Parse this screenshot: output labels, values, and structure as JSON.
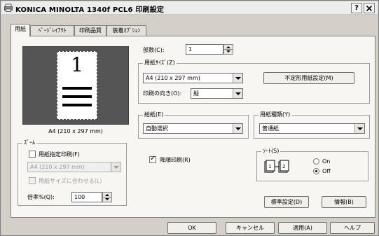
{
  "window": {
    "title": "KONICA MINOLTA 1340f PCL6 印刷設定",
    "help_button": "?",
    "close_button": "X"
  },
  "tabs": [
    {
      "label": "用紙"
    },
    {
      "label": "ﾍﾟｰｼﾞﾚｲｱｳﾄ"
    },
    {
      "label": "印刷品質"
    },
    {
      "label": "装着ｵﾌﾟｼｮﾝ"
    }
  ],
  "preview": {
    "page_number": "1",
    "size_caption": "A4 (210 x 297 mm)"
  },
  "zoom": {
    "group_label": "ｽﾞｰﾑ",
    "paper_specified_label": "用紙指定印刷(F)",
    "paper_size_value": "A4 (210 x 297 mm)",
    "fit_label": "用紙サイズに合わせる(L)",
    "percent_label": "倍率%(Q):",
    "percent_value": "100"
  },
  "copies": {
    "label": "部数(C):",
    "value": "1"
  },
  "paper_size": {
    "group_label": "用紙ｻｲｽﾞ(Z)",
    "value": "A4 (210 x 297 mm)",
    "custom_button": "不定形用紙設定(M)",
    "orientation_label": "印刷の向き(O):",
    "orientation_value": "縦"
  },
  "paper_source": {
    "group_label": "給紙(E)",
    "value": "自動選択"
  },
  "paper_type": {
    "group_label": "用紙種類(Y)",
    "value": "普通紙"
  },
  "reverse_print": {
    "label": "降順印刷(R)",
    "checked": true
  },
  "sort": {
    "group_label": "ｿｰﾄ(S)",
    "on_label": "On",
    "off_label": "Off",
    "selected": "Off"
  },
  "panel_buttons": {
    "defaults": "標準設定(D)",
    "info": "情報(B)"
  },
  "dialog_buttons": {
    "ok": "OK",
    "cancel": "キャンセル",
    "apply": "適用(A)",
    "help": "ヘルプ"
  },
  "colors": {
    "dialog_bg": "#d4d0c8",
    "panel_bg": "#f7f6f3",
    "preview_bg": "#555555"
  }
}
